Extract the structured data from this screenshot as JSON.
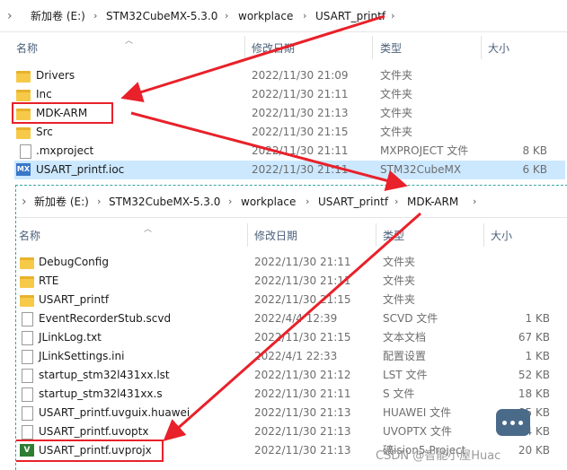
{
  "pane1": {
    "breadcrumb": [
      "新加卷 (E:)",
      "STM32CubeMX-5.3.0",
      "workplace",
      "USART_printf"
    ],
    "columns": {
      "name": "名称",
      "date": "修改日期",
      "type": "类型",
      "size": "大小"
    },
    "rows": [
      {
        "name": "Drivers",
        "date": "2022/11/30 21:09",
        "type": "文件夹",
        "size": "",
        "icon": "folder-icon"
      },
      {
        "name": "Inc",
        "date": "2022/11/30 21:11",
        "type": "文件夹",
        "size": "",
        "icon": "folder-icon"
      },
      {
        "name": "MDK-ARM",
        "date": "2022/11/30 21:13",
        "type": "文件夹",
        "size": "",
        "icon": "folder-icon"
      },
      {
        "name": "Src",
        "date": "2022/11/30 21:15",
        "type": "文件夹",
        "size": "",
        "icon": "folder-icon"
      },
      {
        "name": ".mxproject",
        "date": "2022/11/30 21:11",
        "type": "MXPROJECT 文件",
        "size": "8 KB",
        "icon": "file-icon"
      },
      {
        "name": "USART_printf.ioc",
        "date": "2022/11/30 21:11",
        "type": "STM32CubeMX",
        "size": "6 KB",
        "icon": "cubemx-icon",
        "badge": "MX"
      }
    ]
  },
  "pane2": {
    "breadcrumb": [
      "新加卷 (E:)",
      "STM32CubeMX-5.3.0",
      "workplace",
      "USART_printf",
      "MDK-ARM"
    ],
    "columns": {
      "name": "名称",
      "date": "修改日期",
      "type": "类型",
      "size": "大小"
    },
    "rows": [
      {
        "name": "DebugConfig",
        "date": "2022/11/30 21:11",
        "type": "文件夹",
        "size": "",
        "icon": "folder-icon"
      },
      {
        "name": "RTE",
        "date": "2022/11/30 21:11",
        "type": "文件夹",
        "size": "",
        "icon": "folder-icon"
      },
      {
        "name": "USART_printf",
        "date": "2022/11/30 21:15",
        "type": "文件夹",
        "size": "",
        "icon": "folder-icon"
      },
      {
        "name": "EventRecorderStub.scvd",
        "date": "2022/4/4 12:39",
        "type": "SCVD 文件",
        "size": "1 KB",
        "icon": "file-icon"
      },
      {
        "name": "JLinkLog.txt",
        "date": "2022/11/30 21:15",
        "type": "文本文档",
        "size": "67 KB",
        "icon": "file-icon"
      },
      {
        "name": "JLinkSettings.ini",
        "date": "2022/4/1 22:33",
        "type": "配置设置",
        "size": "1 KB",
        "icon": "file-icon"
      },
      {
        "name": "startup_stm32l431xx.lst",
        "date": "2022/11/30 21:12",
        "type": "LST 文件",
        "size": "52 KB",
        "icon": "file-icon"
      },
      {
        "name": "startup_stm32l431xx.s",
        "date": "2022/11/30 21:11",
        "type": "S 文件",
        "size": "18 KB",
        "icon": "file-icon"
      },
      {
        "name": "USART_printf.uvguix.huawei",
        "date": "2022/11/30 21:13",
        "type": "HUAWEI 文件",
        "size": "85 KB",
        "icon": "file-icon"
      },
      {
        "name": "USART_printf.uvoptx",
        "date": "2022/11/30 21:13",
        "type": "UVOPTX 文件",
        "size": "14 KB",
        "icon": "file-icon"
      },
      {
        "name": "USART_printf.uvprojx",
        "date": "2022/11/30 21:13",
        "type": "礦ision5 Project",
        "size": "20 KB",
        "icon": "uvision-project-icon",
        "badge": "V"
      }
    ]
  },
  "watermark": "CSDN @智能小屋Huac",
  "colors": {
    "selection": "#cce8ff",
    "highlight": "#e8212a",
    "folder": "#f7c948"
  }
}
